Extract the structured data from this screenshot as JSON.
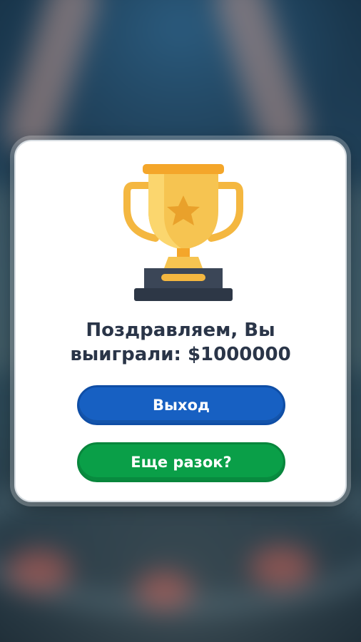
{
  "dialog": {
    "message_line1": "Поздравляем, Вы",
    "message_line2": "выиграли: $1000000",
    "trophy_icon": "trophy-icon",
    "exit_label": "Выход",
    "again_label": "Еще разок?"
  },
  "colors": {
    "exit_button": "#1760c2",
    "again_button": "#0a9f48",
    "trophy_gold": "#f4b740",
    "trophy_base": "#3b4657",
    "text": "#2a3548"
  }
}
